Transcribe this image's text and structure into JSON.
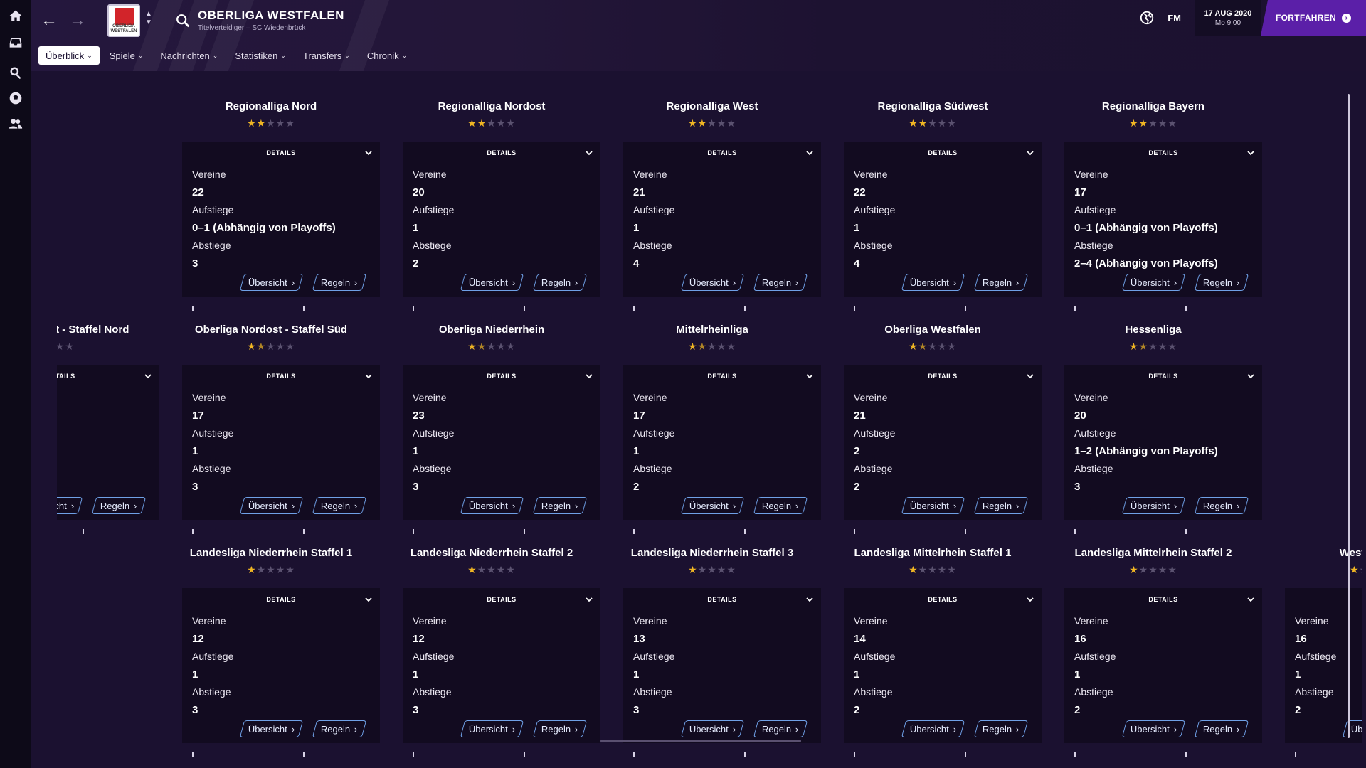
{
  "header": {
    "title": "OBERLIGA WESTFALEN",
    "subtitle": "Titelverteidiger – SC Wiedenbrück",
    "crest_text": "OBERLIGA WESTFALEN",
    "fm_label": "FM",
    "date": "17 AUG 2020",
    "time": "Mo 9:00",
    "continue_label": "FORTFAHREN"
  },
  "tabs": [
    {
      "label": "Überblick",
      "active": true
    },
    {
      "label": "Spiele"
    },
    {
      "label": "Nachrichten"
    },
    {
      "label": "Statistiken"
    },
    {
      "label": "Transfers"
    },
    {
      "label": "Chronik"
    }
  ],
  "labels": {
    "details": "DETAILS",
    "clubs": "Vereine",
    "promotions": "Aufstiege",
    "relegations": "Abstiege",
    "overview": "Übersicht",
    "rules": "Regeln"
  },
  "rows": [
    {
      "cards": [
        {
          "name": "Regionalliga Nord",
          "stars": "2",
          "clubs": "22",
          "promotions": "0–1 (Abhängig von Playoffs)",
          "relegations": "3"
        },
        {
          "name": "Regionalliga Nordost",
          "stars": "2",
          "clubs": "20",
          "promotions": "1",
          "relegations": "2"
        },
        {
          "name": "Regionalliga West",
          "stars": "2",
          "clubs": "21",
          "promotions": "1",
          "relegations": "4"
        },
        {
          "name": "Regionalliga Südwest",
          "stars": "2",
          "clubs": "22",
          "promotions": "1",
          "relegations": "4"
        },
        {
          "name": "Regionalliga Bayern",
          "stars": "2",
          "clubs": "17",
          "promotions": "0–1 (Abhängig von Playoffs)",
          "relegations": "2–4 (Abhängig von Playoffs)"
        }
      ]
    },
    {
      "cards": [
        {
          "name": "Oberliga Nordost - Staffel Nord",
          "stars": "1.5",
          "clubs": "",
          "promotions": "",
          "relegations": ""
        },
        {
          "name": "Oberliga Nordost - Staffel Süd",
          "stars": "1.5",
          "clubs": "17",
          "promotions": "1",
          "relegations": "3"
        },
        {
          "name": "Oberliga Niederrhein",
          "stars": "1.5",
          "clubs": "23",
          "promotions": "1",
          "relegations": "3"
        },
        {
          "name": "Mittelrheinliga",
          "stars": "1.5",
          "clubs": "17",
          "promotions": "1",
          "relegations": "2"
        },
        {
          "name": "Oberliga Westfalen",
          "stars": "1.5",
          "clubs": "21",
          "promotions": "2",
          "relegations": "2"
        },
        {
          "name": "Hessenliga",
          "stars": "1.5",
          "clubs": "20",
          "promotions": "1–2 (Abhängig von Playoffs)",
          "relegations": "3"
        }
      ]
    },
    {
      "cards": [
        {
          "name": "Landesliga Niederrhein Staffel 1",
          "stars": "1",
          "clubs": "12",
          "promotions": "1",
          "relegations": "3"
        },
        {
          "name": "Landesliga Niederrhein Staffel 2",
          "stars": "1",
          "clubs": "12",
          "promotions": "1",
          "relegations": "3"
        },
        {
          "name": "Landesliga Niederrhein Staffel 3",
          "stars": "1",
          "clubs": "13",
          "promotions": "1",
          "relegations": "3"
        },
        {
          "name": "Landesliga Mittelrhein Staffel 1",
          "stars": "1",
          "clubs": "14",
          "promotions": "1",
          "relegations": "2"
        },
        {
          "name": "Landesliga Mittelrhein Staffel 2",
          "stars": "1",
          "clubs": "16",
          "promotions": "1",
          "relegations": "2"
        },
        {
          "name": "Westfalenliga",
          "stars": "1",
          "clubs": "16",
          "promotions": "1",
          "relegations": "2"
        }
      ]
    }
  ],
  "colors": {
    "accent": "#5b1fa8",
    "star": "#f0b623",
    "button_border": "#6fa0e6"
  }
}
